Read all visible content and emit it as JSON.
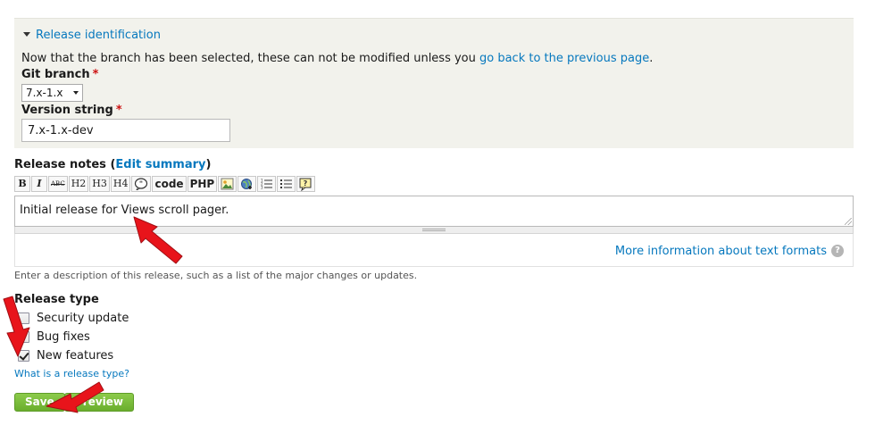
{
  "fieldset": {
    "legend": "Release identification",
    "notice_prefix": "Now that the branch has been selected, these can not be modified unless you ",
    "notice_link": "go back to the previous page",
    "notice_suffix": "."
  },
  "branch": {
    "label": "Git branch",
    "required_mark": "*",
    "value": "7.x-1.x"
  },
  "version": {
    "label": "Version string",
    "required_mark": "*",
    "value": "7.x-1.x-dev"
  },
  "notes": {
    "label": "Release notes",
    "open_paren": " (",
    "edit_summary": "Edit summary",
    "close_paren": ")",
    "toolbar": [
      {
        "name": "bold-button",
        "label": "B"
      },
      {
        "name": "italic-button",
        "label": "I"
      },
      {
        "name": "strikethrough-button",
        "label": "ABC"
      },
      {
        "name": "h2-button",
        "label": "H2"
      },
      {
        "name": "h3-button",
        "label": "H3"
      },
      {
        "name": "h4-button",
        "label": "H4"
      },
      {
        "name": "blockquote-button",
        "label": ""
      },
      {
        "name": "code-button",
        "label": "code"
      },
      {
        "name": "php-button",
        "label": "PHP"
      },
      {
        "name": "image-button",
        "label": ""
      },
      {
        "name": "link-button",
        "label": ""
      },
      {
        "name": "ordered-list-button",
        "label": ""
      },
      {
        "name": "unordered-list-button",
        "label": ""
      },
      {
        "name": "help-button",
        "label": ""
      }
    ],
    "value": "Initial release for Views scroll pager.",
    "formats_link": "More information about text formats",
    "help_glyph": "?",
    "description": "Enter a description of this release, such as a list of the major changes or updates."
  },
  "release_type": {
    "label": "Release type",
    "options": [
      {
        "label": "Security update",
        "checked": false
      },
      {
        "label": "Bug fixes",
        "checked": false
      },
      {
        "label": "New features",
        "checked": true
      }
    ],
    "link": "What is a release type?"
  },
  "buttons": {
    "save": "Save",
    "preview": "Preview"
  },
  "colors": {
    "link": "#0678be",
    "required": "#cc1111",
    "button": "#7ab93a",
    "annotation_arrow": "#e8141b"
  }
}
